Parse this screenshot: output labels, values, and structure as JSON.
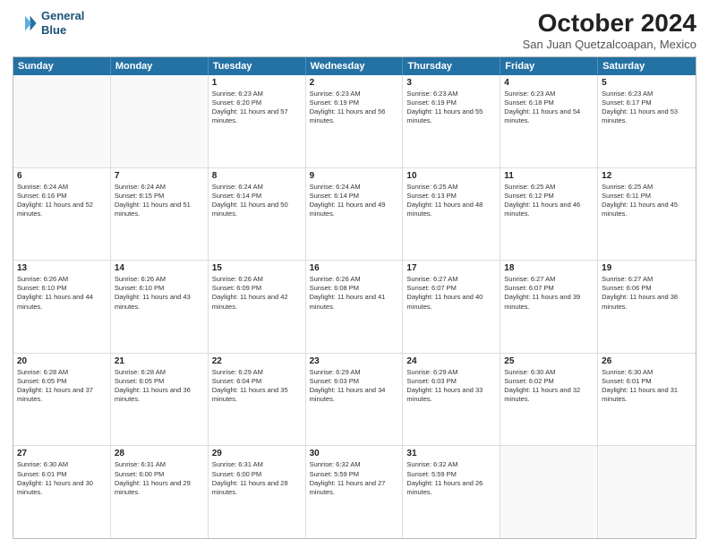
{
  "header": {
    "logo_line1": "General",
    "logo_line2": "Blue",
    "main_title": "October 2024",
    "subtitle": "San Juan Quetzalcoapan, Mexico"
  },
  "weekdays": [
    "Sunday",
    "Monday",
    "Tuesday",
    "Wednesday",
    "Thursday",
    "Friday",
    "Saturday"
  ],
  "rows": [
    [
      {
        "day": "",
        "sunrise": "",
        "sunset": "",
        "daylight": ""
      },
      {
        "day": "",
        "sunrise": "",
        "sunset": "",
        "daylight": ""
      },
      {
        "day": "1",
        "sunrise": "Sunrise: 6:23 AM",
        "sunset": "Sunset: 6:20 PM",
        "daylight": "Daylight: 11 hours and 57 minutes."
      },
      {
        "day": "2",
        "sunrise": "Sunrise: 6:23 AM",
        "sunset": "Sunset: 6:19 PM",
        "daylight": "Daylight: 11 hours and 56 minutes."
      },
      {
        "day": "3",
        "sunrise": "Sunrise: 6:23 AM",
        "sunset": "Sunset: 6:19 PM",
        "daylight": "Daylight: 11 hours and 55 minutes."
      },
      {
        "day": "4",
        "sunrise": "Sunrise: 6:23 AM",
        "sunset": "Sunset: 6:18 PM",
        "daylight": "Daylight: 11 hours and 54 minutes."
      },
      {
        "day": "5",
        "sunrise": "Sunrise: 6:23 AM",
        "sunset": "Sunset: 6:17 PM",
        "daylight": "Daylight: 11 hours and 53 minutes."
      }
    ],
    [
      {
        "day": "6",
        "sunrise": "Sunrise: 6:24 AM",
        "sunset": "Sunset: 6:16 PM",
        "daylight": "Daylight: 11 hours and 52 minutes."
      },
      {
        "day": "7",
        "sunrise": "Sunrise: 6:24 AM",
        "sunset": "Sunset: 6:15 PM",
        "daylight": "Daylight: 11 hours and 51 minutes."
      },
      {
        "day": "8",
        "sunrise": "Sunrise: 6:24 AM",
        "sunset": "Sunset: 6:14 PM",
        "daylight": "Daylight: 11 hours and 50 minutes."
      },
      {
        "day": "9",
        "sunrise": "Sunrise: 6:24 AM",
        "sunset": "Sunset: 6:14 PM",
        "daylight": "Daylight: 11 hours and 49 minutes."
      },
      {
        "day": "10",
        "sunrise": "Sunrise: 6:25 AM",
        "sunset": "Sunset: 6:13 PM",
        "daylight": "Daylight: 11 hours and 48 minutes."
      },
      {
        "day": "11",
        "sunrise": "Sunrise: 6:25 AM",
        "sunset": "Sunset: 6:12 PM",
        "daylight": "Daylight: 11 hours and 46 minutes."
      },
      {
        "day": "12",
        "sunrise": "Sunrise: 6:25 AM",
        "sunset": "Sunset: 6:11 PM",
        "daylight": "Daylight: 11 hours and 45 minutes."
      }
    ],
    [
      {
        "day": "13",
        "sunrise": "Sunrise: 6:26 AM",
        "sunset": "Sunset: 6:10 PM",
        "daylight": "Daylight: 11 hours and 44 minutes."
      },
      {
        "day": "14",
        "sunrise": "Sunrise: 6:26 AM",
        "sunset": "Sunset: 6:10 PM",
        "daylight": "Daylight: 11 hours and 43 minutes."
      },
      {
        "day": "15",
        "sunrise": "Sunrise: 6:26 AM",
        "sunset": "Sunset: 6:09 PM",
        "daylight": "Daylight: 11 hours and 42 minutes."
      },
      {
        "day": "16",
        "sunrise": "Sunrise: 6:26 AM",
        "sunset": "Sunset: 6:08 PM",
        "daylight": "Daylight: 11 hours and 41 minutes."
      },
      {
        "day": "17",
        "sunrise": "Sunrise: 6:27 AM",
        "sunset": "Sunset: 6:07 PM",
        "daylight": "Daylight: 11 hours and 40 minutes."
      },
      {
        "day": "18",
        "sunrise": "Sunrise: 6:27 AM",
        "sunset": "Sunset: 6:07 PM",
        "daylight": "Daylight: 11 hours and 39 minutes."
      },
      {
        "day": "19",
        "sunrise": "Sunrise: 6:27 AM",
        "sunset": "Sunset: 6:06 PM",
        "daylight": "Daylight: 11 hours and 38 minutes."
      }
    ],
    [
      {
        "day": "20",
        "sunrise": "Sunrise: 6:28 AM",
        "sunset": "Sunset: 6:05 PM",
        "daylight": "Daylight: 11 hours and 37 minutes."
      },
      {
        "day": "21",
        "sunrise": "Sunrise: 6:28 AM",
        "sunset": "Sunset: 6:05 PM",
        "daylight": "Daylight: 11 hours and 36 minutes."
      },
      {
        "day": "22",
        "sunrise": "Sunrise: 6:29 AM",
        "sunset": "Sunset: 6:04 PM",
        "daylight": "Daylight: 11 hours and 35 minutes."
      },
      {
        "day": "23",
        "sunrise": "Sunrise: 6:29 AM",
        "sunset": "Sunset: 6:03 PM",
        "daylight": "Daylight: 11 hours and 34 minutes."
      },
      {
        "day": "24",
        "sunrise": "Sunrise: 6:29 AM",
        "sunset": "Sunset: 6:03 PM",
        "daylight": "Daylight: 11 hours and 33 minutes."
      },
      {
        "day": "25",
        "sunrise": "Sunrise: 6:30 AM",
        "sunset": "Sunset: 6:02 PM",
        "daylight": "Daylight: 11 hours and 32 minutes."
      },
      {
        "day": "26",
        "sunrise": "Sunrise: 6:30 AM",
        "sunset": "Sunset: 6:01 PM",
        "daylight": "Daylight: 11 hours and 31 minutes."
      }
    ],
    [
      {
        "day": "27",
        "sunrise": "Sunrise: 6:30 AM",
        "sunset": "Sunset: 6:01 PM",
        "daylight": "Daylight: 11 hours and 30 minutes."
      },
      {
        "day": "28",
        "sunrise": "Sunrise: 6:31 AM",
        "sunset": "Sunset: 6:00 PM",
        "daylight": "Daylight: 11 hours and 29 minutes."
      },
      {
        "day": "29",
        "sunrise": "Sunrise: 6:31 AM",
        "sunset": "Sunset: 6:00 PM",
        "daylight": "Daylight: 11 hours and 28 minutes."
      },
      {
        "day": "30",
        "sunrise": "Sunrise: 6:32 AM",
        "sunset": "Sunset: 5:59 PM",
        "daylight": "Daylight: 11 hours and 27 minutes."
      },
      {
        "day": "31",
        "sunrise": "Sunrise: 6:32 AM",
        "sunset": "Sunset: 5:59 PM",
        "daylight": "Daylight: 11 hours and 26 minutes."
      },
      {
        "day": "",
        "sunrise": "",
        "sunset": "",
        "daylight": ""
      },
      {
        "day": "",
        "sunrise": "",
        "sunset": "",
        "daylight": ""
      }
    ]
  ]
}
